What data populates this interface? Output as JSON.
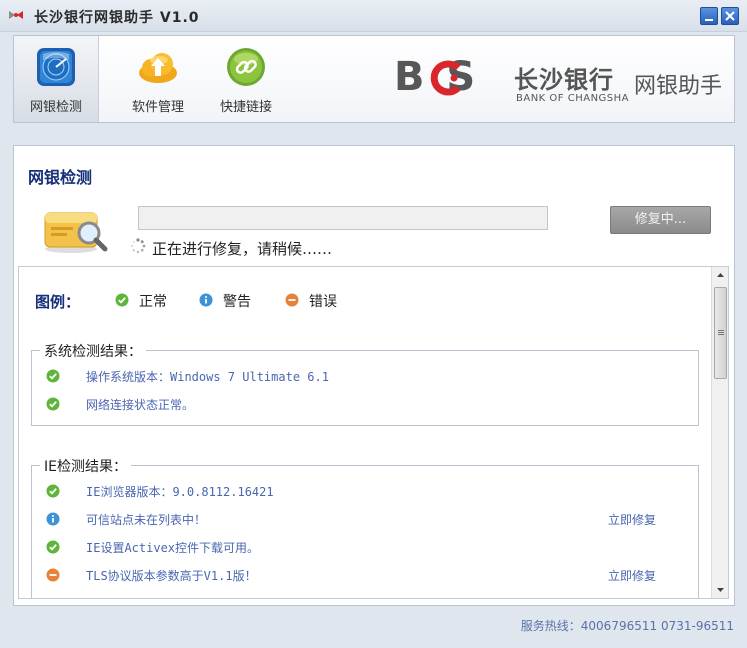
{
  "window": {
    "title": "长沙银行网银助手 V1.0"
  },
  "toolbar": {
    "items": [
      {
        "label": "网银检测"
      },
      {
        "label": "软件管理"
      },
      {
        "label": "快捷链接"
      }
    ]
  },
  "logo": {
    "letters": "BCS",
    "name_cn": "长沙银行",
    "name_en": "BANK OF CHANGSHA",
    "product": "网银助手"
  },
  "main": {
    "section_title": "网银检测",
    "status_text": "正在进行修复，请稍候……",
    "repair_button": "修复中...",
    "progress": 0
  },
  "legend": {
    "title": "图例：",
    "items": [
      {
        "label": "正常",
        "color": "#5fb53a"
      },
      {
        "label": "警告",
        "color": "#3e92d6"
      },
      {
        "label": "错误",
        "color": "#e6823c"
      }
    ]
  },
  "groups": [
    {
      "title": "系统检测结果：",
      "rows": [
        {
          "status": "ok",
          "text": "操作系统版本：Windows 7 Ultimate 6.1",
          "action": ""
        },
        {
          "status": "ok",
          "text": "网络连接状态正常。",
          "action": ""
        }
      ]
    },
    {
      "title": "IE检测结果：",
      "rows": [
        {
          "status": "ok",
          "text": "IE浏览器版本：9.0.8112.16421",
          "action": ""
        },
        {
          "status": "warn",
          "text": "可信站点未在列表中！",
          "action": "立即修复"
        },
        {
          "status": "ok",
          "text": "IE设置Activex控件下载可用。",
          "action": ""
        },
        {
          "status": "error",
          "text": "TLS协议版本参数高于V1.1版！",
          "action": "立即修复"
        }
      ]
    }
  ],
  "footer": {
    "hotline": "服务热线：4006796511  0731-96511"
  }
}
